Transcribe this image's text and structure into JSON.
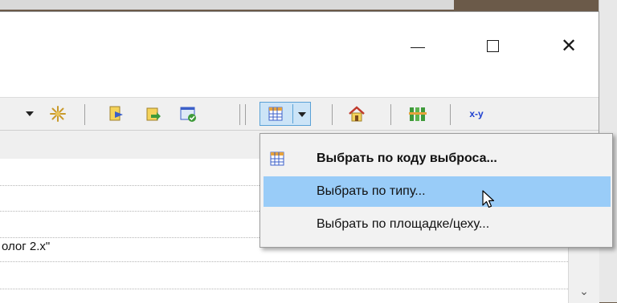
{
  "window": {
    "caption_buttons": {
      "minimize_icon": "minimize-icon",
      "maximize_icon": "maximize-icon",
      "close_glyph": "✕"
    }
  },
  "toolbar": {
    "icons": [
      "dropdown-arrow-icon",
      "snowflake-icon",
      "document-arrow-icon",
      "folder-export-icon",
      "window-check-icon",
      "grid-icon",
      "dropdown-arrow-icon",
      "home-icon",
      "tree-icon",
      "xy-icon"
    ],
    "xy_label": "x-y"
  },
  "table": {
    "row_text": "олог  2.х\""
  },
  "context_menu": {
    "items": [
      {
        "label": "Выбрать по коду выброса...",
        "icon": "grid-icon",
        "bold": true
      },
      {
        "label": "Выбрать по типу...",
        "hover": true
      },
      {
        "label": "Выбрать по площадке/цеху..."
      }
    ]
  },
  "colors": {
    "menu_hover": "#99ccf8",
    "toolbar_bg": "#f0f0f0",
    "desktop_bg": "#6b5a49"
  }
}
